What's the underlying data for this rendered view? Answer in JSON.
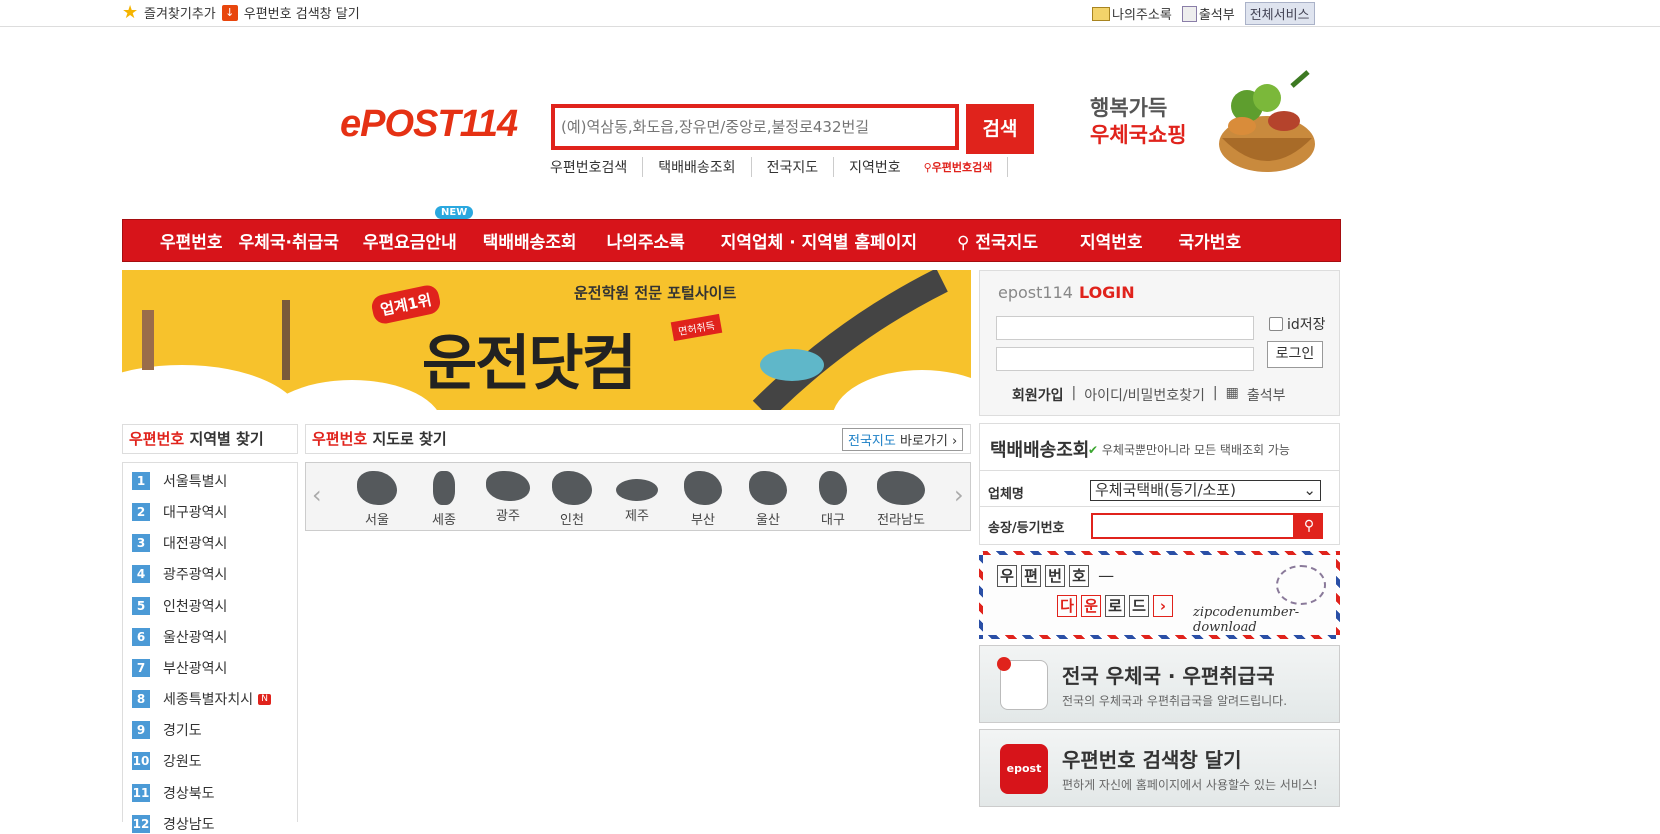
{
  "topbar": {
    "bookmark": "즐겨찾기추가",
    "widget": "우편번호 검색창 달기",
    "my_address": "나의주소록",
    "attendance": "출석부",
    "all_services": "전체서비스"
  },
  "logo": "ePOST114",
  "search": {
    "placeholder": "(예)역삼동,화도읍,장유면/중앙로,불정로432번길",
    "button": "검색",
    "links": [
      "우편번호검색",
      "택배배송조회",
      "전국지도",
      "지역번호"
    ],
    "mini_link": "우편번호검색"
  },
  "shop": {
    "line1": "행복가득",
    "line2": "우체국쇼핑"
  },
  "nav": {
    "items": [
      "우편번호",
      "우체국·취급국",
      "우편요금안내",
      "택배배송조회",
      "나의주소록",
      "지역업체 · 지역별 홈페이지",
      "전국지도",
      "지역번호",
      "국가번호"
    ],
    "new_badge": "NEW"
  },
  "banner": {
    "rank": "업계1위",
    "tagline": "운전학원 전문 포털사이트",
    "title": "운전닷컴",
    "flag": "면허취득"
  },
  "login": {
    "label": "epost114",
    "login": "LOGIN",
    "remember": "id저장",
    "button": "로그인",
    "signup": "회원가입",
    "find": "아이디/비밀번호찾기",
    "attendance": "출석부"
  },
  "region_panel": {
    "title_em": "우편번호",
    "title": "지역별 찾기",
    "items": [
      "서울특별시",
      "대구광역시",
      "대전광역시",
      "광주광역시",
      "인천광역시",
      "울산광역시",
      "부산광역시",
      "세종특별자치시",
      "경기도",
      "강원도",
      "경상북도",
      "경상남도"
    ],
    "new_mark": "N"
  },
  "map_panel": {
    "title_em": "우편번호",
    "title": "지도로 찾기",
    "goto_em": "전국지도",
    "goto": "바로가기",
    "regions": [
      "서울",
      "세종",
      "광주",
      "인천",
      "제주",
      "부산",
      "울산",
      "대구",
      "전라남도"
    ]
  },
  "track": {
    "title": "택배배송조회",
    "sub": "우체국뿐만아니라 모든 택배조회 가능",
    "company_label": "업체명",
    "company_value": "우체국택배(등기/소포)",
    "number_label": "송장/등기번호"
  },
  "postcode_widget": {
    "line1": [
      "우",
      "편",
      "번",
      "호"
    ],
    "line2": [
      "다",
      "운",
      "로",
      "드"
    ],
    "sig": "zipcodenumber-download"
  },
  "promos": [
    {
      "title": "전국 우체국 · 우편취급국",
      "sub": "전국의 우체국과 우편취급국을 알려드립니다."
    },
    {
      "title": "우편번호 검색창 달기",
      "sub": "편하게 자신에 홈페이지에서 사용할수 있는 서비스!"
    }
  ],
  "colors": {
    "brand_red": "#e0231c",
    "nav_red": "#d7141a",
    "number_blue": "#4b9ad6"
  }
}
